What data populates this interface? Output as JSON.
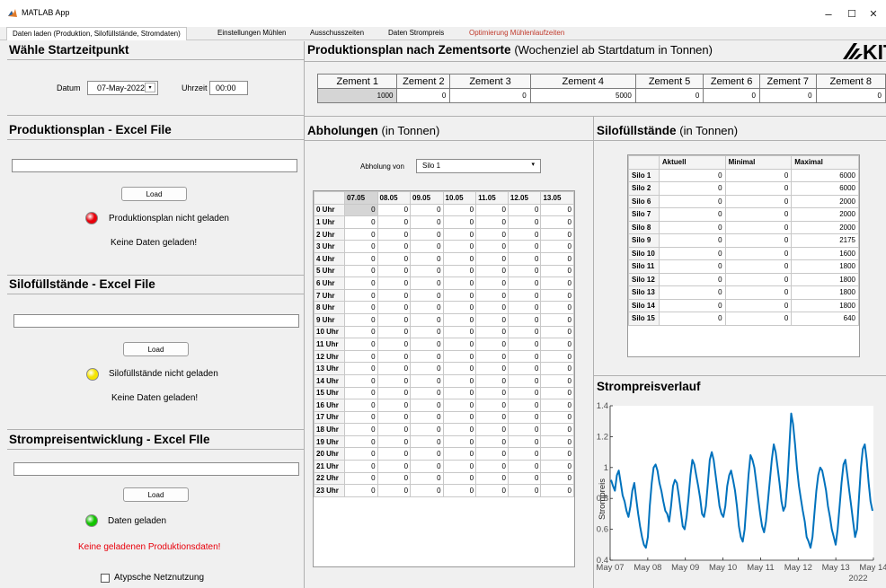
{
  "window": {
    "title": "MATLAB App",
    "minimize": "–",
    "maximize": "☐",
    "close": "✕"
  },
  "tabs": [
    {
      "label": "Daten laden (Produktion, Silofüllstände, Stromdaten)"
    },
    {
      "label": "Einstellungen Mühlen"
    },
    {
      "label": "Ausschusszeiten"
    },
    {
      "label": "Daten Strompreis"
    },
    {
      "label": "Optimierung Mühlenlaufzeiten"
    }
  ],
  "start": {
    "title": "Wähle Startzeitpunkt",
    "date_label": "Datum",
    "date_value": "07-May-2022",
    "time_label": "Uhrzeit",
    "time_value": "00:00"
  },
  "prod_excel": {
    "title": "Produktionsplan - Excel File",
    "path": "",
    "load": "Load",
    "status": "Produktionsplan nicht geladen",
    "info": "Keine Daten geladen!",
    "lamp_color": "#e8000b"
  },
  "silo_excel": {
    "title": "Silofüllstände - Excel File",
    "path": "",
    "load": "Load",
    "status": "Silofüllstände nicht geladen",
    "info": "Keine Daten geladen!",
    "lamp_color": "#f5e400"
  },
  "strom_excel": {
    "title": "Strompreisentwicklung - Excel FIle",
    "path": "",
    "load": "Load",
    "status": "Daten geladen",
    "info": "Keine geladenen Produktionsdaten!",
    "info_color": "#e8000b",
    "lamp_color": "#12c400",
    "checkbox": "Atypsche Netznutzung"
  },
  "zement": {
    "title": "Produktionsplan nach Zementsorte",
    "subtitle": "(Wochenziel ab Startdatum in Tonnen)",
    "logo": "KIT",
    "columns": [
      "Zement 1",
      "Zement 2",
      "Zement 3",
      "Zement 4",
      "Zement 5",
      "Zement 6",
      "Zement 7",
      "Zement 8"
    ],
    "values": [
      "1000",
      "0",
      "0",
      "5000",
      "0",
      "0",
      "0",
      "0"
    ]
  },
  "abholungen": {
    "title": "Abholungen",
    "subtitle": "(in Tonnen)",
    "von_label": "Abholung von",
    "von_value": "Silo 1",
    "columns": [
      "07.05",
      "08.05",
      "09.05",
      "10.05",
      "11.05",
      "12.05",
      "13.05"
    ],
    "rows": [
      "0 Uhr",
      "1 Uhr",
      "2 Uhr",
      "3 Uhr",
      "4 Uhr",
      "5 Uhr",
      "6 Uhr",
      "7 Uhr",
      "8 Uhr",
      "9 Uhr",
      "10 Uhr",
      "11 Uhr",
      "12 Uhr",
      "13 Uhr",
      "14 Uhr",
      "15 Uhr",
      "16 Uhr",
      "17 Uhr",
      "18 Uhr",
      "19 Uhr",
      "20 Uhr",
      "21 Uhr",
      "22 Uhr",
      "23 Uhr"
    ],
    "cell_value": "0"
  },
  "silo": {
    "title": "Silofüllstände",
    "subtitle": "(in Tonnen)",
    "columns": [
      "Aktuell",
      "Minimal",
      "Maximal"
    ],
    "rows": [
      {
        "name": "Silo 1",
        "akt": "0",
        "min": "0",
        "max": "6000"
      },
      {
        "name": "Silo 2",
        "akt": "0",
        "min": "0",
        "max": "6000"
      },
      {
        "name": "Silo 6",
        "akt": "0",
        "min": "0",
        "max": "2000"
      },
      {
        "name": "Silo 7",
        "akt": "0",
        "min": "0",
        "max": "2000"
      },
      {
        "name": "Silo 8",
        "akt": "0",
        "min": "0",
        "max": "2000"
      },
      {
        "name": "Silo 9",
        "akt": "0",
        "min": "0",
        "max": "2175"
      },
      {
        "name": "Silo 10",
        "akt": "0",
        "min": "0",
        "max": "1600"
      },
      {
        "name": "Silo 11",
        "akt": "0",
        "min": "0",
        "max": "1800"
      },
      {
        "name": "Silo 12",
        "akt": "0",
        "min": "0",
        "max": "1800"
      },
      {
        "name": "Silo 13",
        "akt": "0",
        "min": "0",
        "max": "1800"
      },
      {
        "name": "Silo 14",
        "akt": "0",
        "min": "0",
        "max": "1800"
      },
      {
        "name": "Silo 15",
        "akt": "0",
        "min": "0",
        "max": "640"
      }
    ]
  },
  "chart_data": {
    "type": "line",
    "title": "Strompreisverlauf",
    "ylabel": "Strompreis",
    "xlabel": "",
    "year_label": "2022",
    "ylim": [
      0.4,
      1.4
    ],
    "yticks": [
      "1.4",
      "1.2",
      "1",
      "0.8",
      "0.6",
      "0.4"
    ],
    "ytick_values": [
      1.4,
      1.2,
      1.0,
      0.8,
      0.6,
      0.4
    ],
    "xticks": [
      "May 07",
      "May 08",
      "May 09",
      "May 10",
      "May 11",
      "May 12",
      "May 13",
      "May 14"
    ],
    "xlim_days": [
      0,
      7
    ],
    "color": "#0072bd",
    "series": [
      {
        "values": [
          0.92,
          0.88,
          0.85,
          0.95,
          0.98,
          0.9,
          0.82,
          0.78,
          0.72,
          0.68,
          0.75,
          0.85,
          0.9,
          0.8,
          0.7,
          0.62,
          0.55,
          0.5,
          0.48,
          0.55,
          0.75,
          0.9,
          1.0,
          1.02,
          0.98,
          0.9,
          0.85,
          0.78,
          0.72,
          0.7,
          0.65,
          0.75,
          0.88,
          0.92,
          0.9,
          0.82,
          0.72,
          0.62,
          0.6,
          0.68,
          0.8,
          0.95,
          1.05,
          1.02,
          0.95,
          0.88,
          0.8,
          0.7,
          0.68,
          0.75,
          0.9,
          1.05,
          1.1,
          1.05,
          0.95,
          0.85,
          0.75,
          0.7,
          0.68,
          0.75,
          0.88,
          0.95,
          0.98,
          0.92,
          0.85,
          0.75,
          0.62,
          0.55,
          0.52,
          0.6,
          0.78,
          0.95,
          1.08,
          1.05,
          1.0,
          0.9,
          0.8,
          0.7,
          0.62,
          0.58,
          0.65,
          0.78,
          0.92,
          1.05,
          1.15,
          1.1,
          1.0,
          0.9,
          0.78,
          0.72,
          0.75,
          0.9,
          1.12,
          1.35,
          1.28,
          1.15,
          1.0,
          0.88,
          0.8,
          0.72,
          0.65,
          0.55,
          0.52,
          0.48,
          0.55,
          0.7,
          0.85,
          0.95,
          1.0,
          0.98,
          0.92,
          0.85,
          0.75,
          0.68,
          0.6,
          0.55,
          0.5,
          0.6,
          0.75,
          0.9,
          1.02,
          1.05,
          0.95,
          0.85,
          0.75,
          0.65,
          0.55,
          0.6,
          0.8,
          1.0,
          1.12,
          1.15,
          1.05,
          0.9,
          0.78,
          0.72
        ]
      }
    ]
  }
}
